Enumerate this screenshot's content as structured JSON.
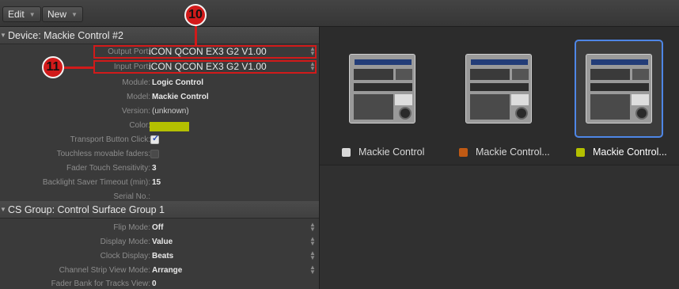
{
  "toolbar": {
    "edit_label": "Edit",
    "new_label": "New"
  },
  "device_section": {
    "header": "Device:  Mackie Control #2",
    "output_port_label": "Output Port:",
    "output_port_value": "iCON QCON EX3 G2 V1.00",
    "input_port_label": "Input Port:",
    "input_port_value": "iCON QCON EX3 G2 V1.00",
    "module_label": "Module:",
    "module_value": "Logic Control",
    "model_label": "Model:",
    "model_value": "Mackie Control",
    "version_label": "Version:",
    "version_value": "(unknown)",
    "color_label": "Color:",
    "color_value": "#b4c000",
    "transport_click_label": "Transport Button Click:",
    "transport_click_checked": true,
    "touchless_label": "Touchless movable faders:",
    "touchless_checked": false,
    "fader_touch_label": "Fader Touch Sensitivity:",
    "fader_touch_value": "3",
    "backlight_label": "Backlight Saver Timeout (min):",
    "backlight_value": "15",
    "serial_label": "Serial No.:",
    "serial_value": ""
  },
  "group_section": {
    "header": "CS Group:  Control Surface Group 1",
    "flip_label": "Flip Mode:",
    "flip_value": "Off",
    "display_label": "Display Mode:",
    "display_value": "Value",
    "clock_label": "Clock Display:",
    "clock_value": "Beats",
    "channel_strip_label": "Channel Strip View Mode:",
    "channel_strip_value": "Arrange",
    "fader_bank_label": "Fader Bank for Tracks View:",
    "fader_bank_value": "0"
  },
  "callouts": {
    "c10": "10",
    "c11": "11"
  },
  "devices": [
    {
      "label": "Mackie Control",
      "color": "#d8d8d8",
      "selected": false
    },
    {
      "label": "Mackie Control...",
      "color": "#c05a14",
      "selected": false
    },
    {
      "label": "Mackie Control...",
      "color": "#b4c000",
      "selected": true
    }
  ]
}
